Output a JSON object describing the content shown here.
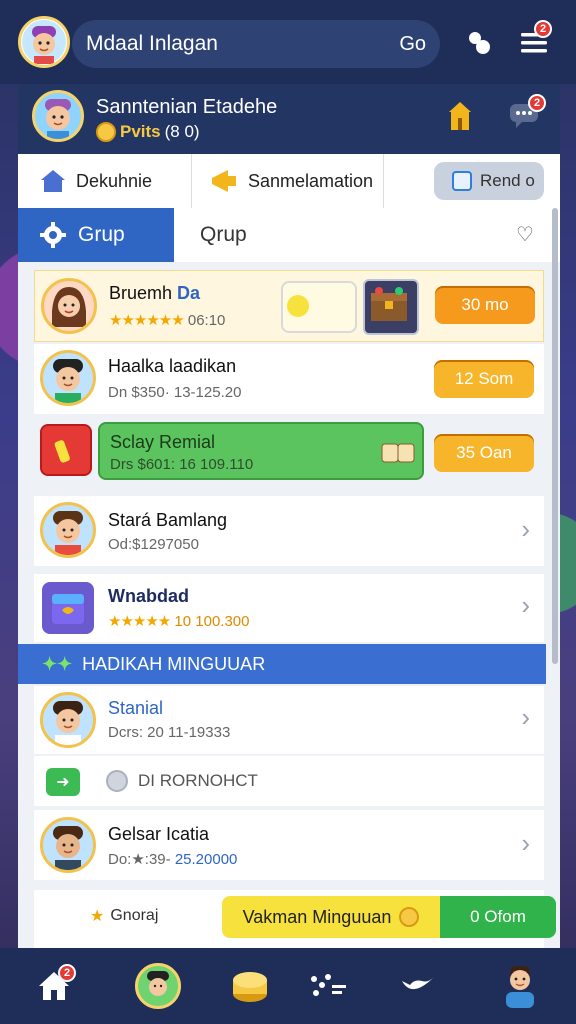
{
  "topbar": {
    "search_text": "Mdaal Inlagan",
    "go_label": "Go",
    "menu_badge": "2"
  },
  "profile": {
    "name": "Sanntenian Etadehe",
    "coins_num": "Pvits",
    "coins_extra": "(8 0)",
    "chat_badge": "2"
  },
  "tabs_top": [
    {
      "label": "Dekuhnie"
    },
    {
      "label": "Sanmelamation"
    },
    {
      "label": "Rend o"
    }
  ],
  "tabs_group": {
    "active": "Grup",
    "inactive": "Qrup"
  },
  "rows": [
    {
      "name": "Bruemh",
      "tag": "Da",
      "sub_stars": "★★★★★★",
      "sub": "06:10",
      "button": "30 mo"
    },
    {
      "name": "Haalka laadikan",
      "sub": "Dn $350· 13-125.20",
      "button": "12 Som"
    },
    {
      "name": "Sclay Remial",
      "sub": "Drs $601: 16 109.110",
      "button": "35 Oan"
    },
    {
      "name": "Stará Bamlang",
      "sub": "Od:$1297050"
    },
    {
      "name": "Wnabdad",
      "sub_stars": "★★★★★",
      "sub": "10 100.300"
    }
  ],
  "section_title": "HADIKAH MINGUUAR",
  "rows_lower": [
    {
      "name": "Stanial",
      "sub": "Dcrs: 20  11-19333"
    },
    {
      "name": "DI RORNOHCT"
    },
    {
      "name": "Gelsar Icatia",
      "sub_prefix": "Do:★:39-",
      "sub_value": "25.20000"
    }
  ],
  "footer": {
    "left_label": "Gnoraj",
    "yellow_label": "Vakman Minguuan",
    "green_label": "0 Ofom"
  },
  "bottom_nav": {
    "home_badge": "2"
  },
  "colors": {
    "header_bg": "#1f2e58",
    "accent_blue": "#2f66c4",
    "orange": "#f59a1c",
    "green": "#2fb34a",
    "yellow": "#f7e23d"
  }
}
